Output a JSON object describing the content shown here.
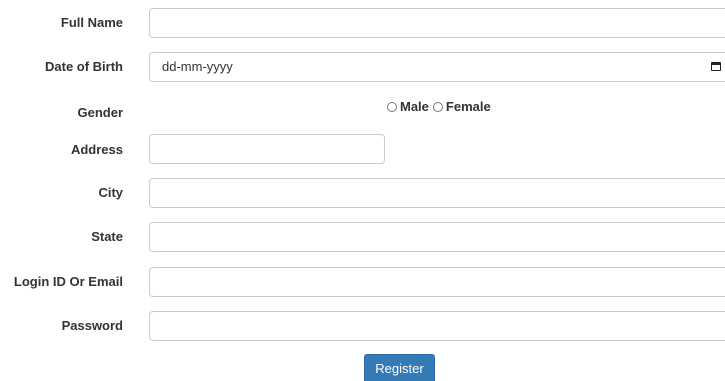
{
  "form": {
    "full_name": {
      "label": "Full Name",
      "value": "",
      "placeholder": ""
    },
    "date_of_birth": {
      "label": "Date of Birth",
      "value": "dd-mm-yyyy"
    },
    "gender": {
      "label": "Gender",
      "options": [
        {
          "label": "Male",
          "selected": false
        },
        {
          "label": "Female",
          "selected": false
        }
      ]
    },
    "address": {
      "label": "Address",
      "value": "",
      "placeholder": ""
    },
    "city": {
      "label": "City",
      "value": "",
      "placeholder": ""
    },
    "state": {
      "label": "State",
      "value": "",
      "placeholder": ""
    },
    "login": {
      "label": "Login ID Or Email",
      "value": "",
      "placeholder": ""
    },
    "password": {
      "label": "Password",
      "value": "",
      "placeholder": ""
    },
    "register_label": "Register"
  },
  "icons": {
    "date_picker": "calendar-icon",
    "radio": "radio-button-icon"
  },
  "colors": {
    "primary_button": "#337ab7",
    "input_border": "#cccccc",
    "label_text": "#333333"
  }
}
